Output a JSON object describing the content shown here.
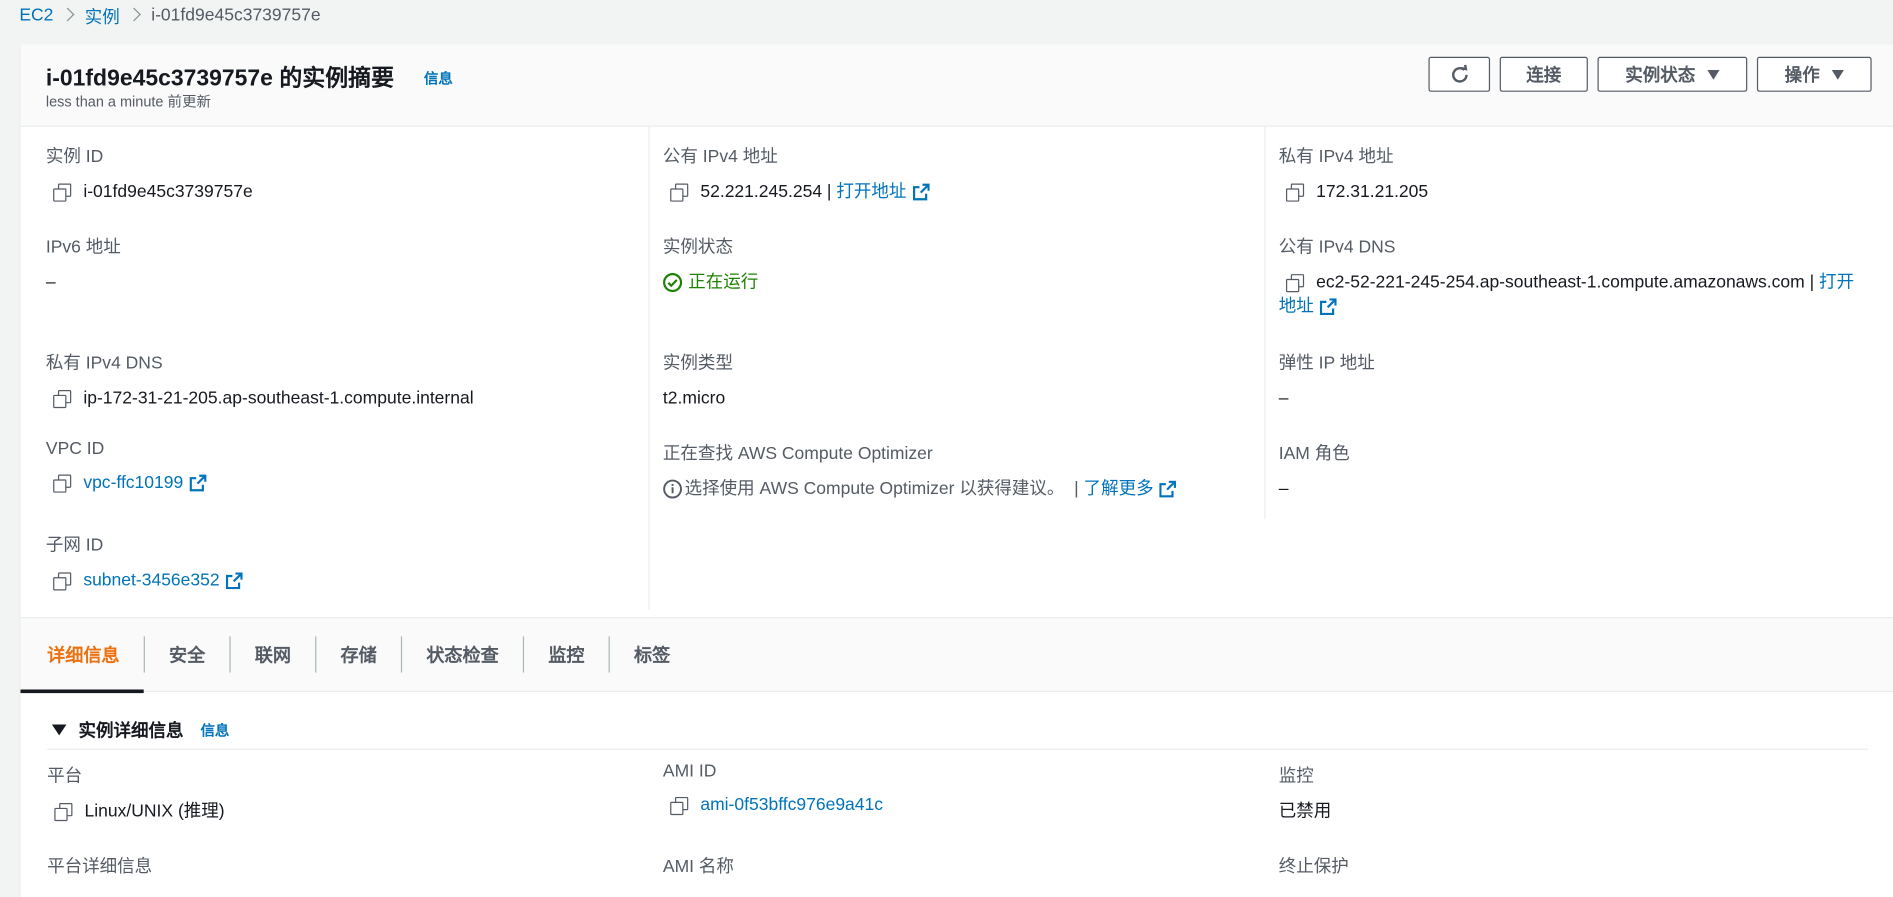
{
  "breadcrumb": {
    "root": "EC2",
    "section": "实例",
    "current": "i-01fd9e45c3739757e"
  },
  "header": {
    "title": "i-01fd9e45c3739757e 的实例摘要",
    "info": "信息",
    "updated": "less than a minute 前更新",
    "buttons": {
      "refresh_icon": "refresh-icon",
      "connect": "连接",
      "instance_state": "实例状态",
      "actions": "操作"
    }
  },
  "summary": {
    "instance_id": {
      "label": "实例 ID",
      "value": "i-01fd9e45c3739757e"
    },
    "public_ipv4": {
      "label": "公有 IPv4 地址",
      "value": "52.221.245.254",
      "sep": "|",
      "link": "打开地址"
    },
    "private_ipv4": {
      "label": "私有 IPv4 地址",
      "value": "172.31.21.205"
    },
    "ipv6": {
      "label": "IPv6 地址",
      "value": "–"
    },
    "state": {
      "label": "实例状态",
      "value": "正在运行",
      "color": "#1d8102"
    },
    "public_dns": {
      "label": "公有 IPv4 DNS",
      "value": "ec2-52-221-245-254.ap-southeast-1.compute.amazonaws.com",
      "sep": "|",
      "link_part1": "打开",
      "link_part2": "地址"
    },
    "private_dns": {
      "label": "私有 IPv4 DNS",
      "value": "ip-172-31-21-205.ap-southeast-1.compute.internal"
    },
    "instance_type": {
      "label": "实例类型",
      "value": "t2.micro"
    },
    "elastic_ip": {
      "label": "弹性 IP 地址",
      "value": "–"
    },
    "vpc_id": {
      "label": "VPC ID",
      "value": "vpc-ffc10199"
    },
    "optimizer": {
      "label": "正在查找 AWS Compute Optimizer",
      "value": "选择使用 AWS Compute Optimizer 以获得建议。",
      "sep": "|",
      "link": "了解更多"
    },
    "iam_role": {
      "label": "IAM 角色",
      "value": "–"
    },
    "subnet_id": {
      "label": "子网 ID",
      "value": "subnet-3456e352"
    }
  },
  "tabs": [
    "详细信息",
    "安全",
    "联网",
    "存储",
    "状态检查",
    "监控",
    "标签"
  ],
  "details": {
    "title": "实例详细信息",
    "info": "信息",
    "platform": {
      "label": "平台",
      "value": "Linux/UNIX (推理)"
    },
    "ami_id": {
      "label": "AMI ID",
      "value": "ami-0f53bffc976e9a41c"
    },
    "monitoring": {
      "label": "监控",
      "value": "已禁用"
    },
    "platform_details": {
      "label": "平台详细信息"
    },
    "ami_name": {
      "label": "AMI 名称"
    },
    "termination_protection": {
      "label": "终止保护"
    }
  },
  "colors": {
    "link": "#0073bb",
    "active_tab": "#ec7211",
    "success": "#1d8102"
  }
}
